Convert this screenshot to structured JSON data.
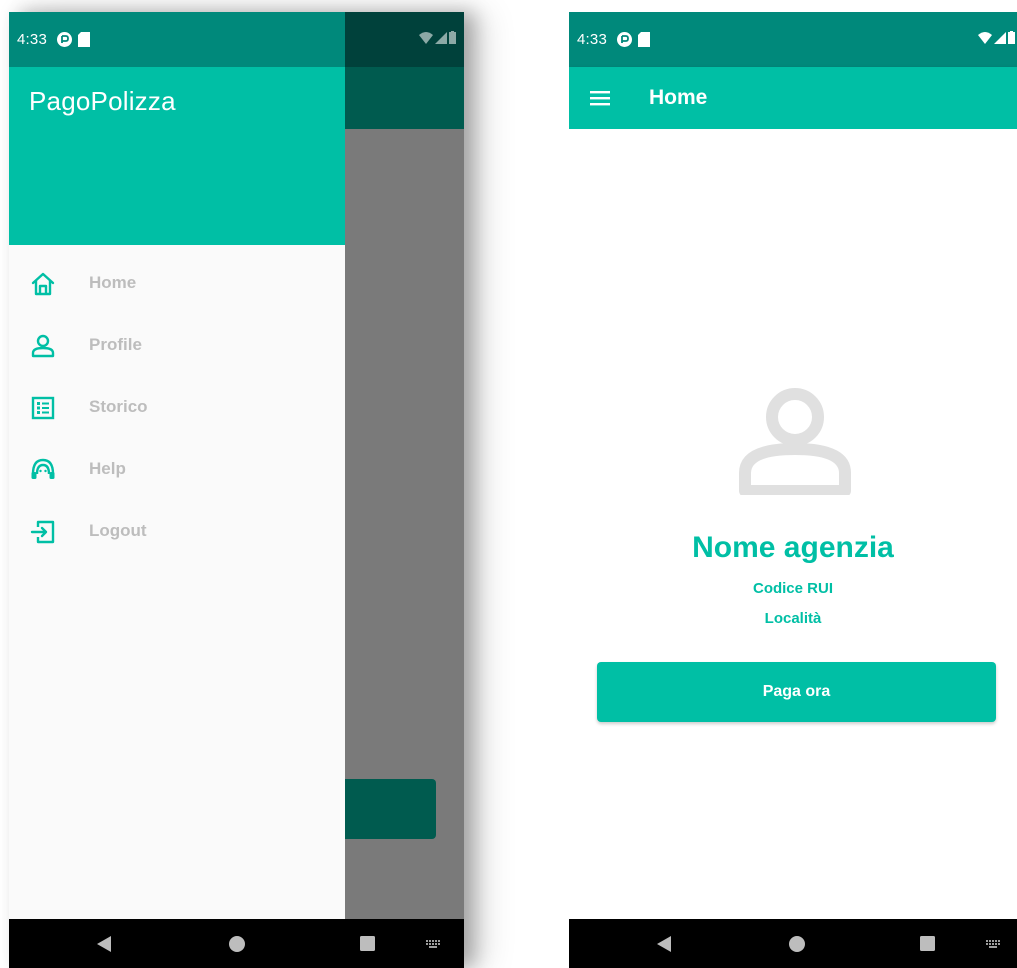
{
  "status_bar": {
    "time": "4:33"
  },
  "drawer": {
    "title": "PagoPolizza",
    "items": [
      {
        "label": "Home",
        "icon": "home-icon"
      },
      {
        "label": "Profile",
        "icon": "person-icon"
      },
      {
        "label": "Storico",
        "icon": "list-icon"
      },
      {
        "label": "Help",
        "icon": "headset-icon"
      },
      {
        "label": "Logout",
        "icon": "logout-icon"
      }
    ]
  },
  "home": {
    "appbar_title": "Home",
    "agency_name": "Nome agenzia",
    "agency_code": "Codice RUI",
    "agency_location": "Località",
    "pay_button_label": "Paga ora"
  },
  "colors": {
    "primary": "#00bfa5",
    "primary_dark": "#00897b",
    "drawer_label": "#bdbdbd",
    "avatar_placeholder": "#e0e0e0"
  }
}
